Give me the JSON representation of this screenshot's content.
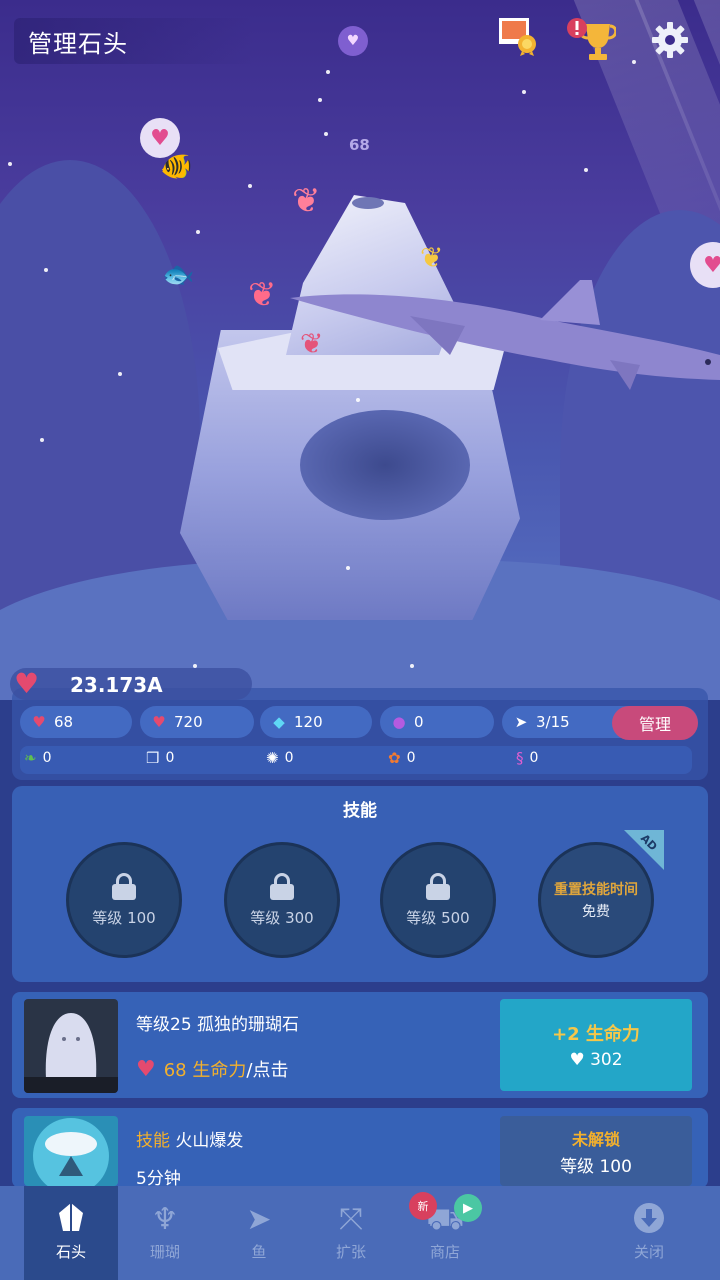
{
  "header": {
    "title": "管理石头",
    "floating_number": "68"
  },
  "stats": {
    "life_total": "23.173A",
    "chips": [
      {
        "icon": "heart-tap-icon",
        "value": "68"
      },
      {
        "icon": "heart-auto-icon",
        "value": "720"
      },
      {
        "icon": "diamond-icon",
        "value": "120"
      },
      {
        "icon": "pearl-icon",
        "value": "0"
      },
      {
        "icon": "fish-count-icon",
        "value": "3/15"
      }
    ],
    "manage_label": "管理",
    "resources": [
      {
        "icon": "seaweed-icon",
        "value": "0"
      },
      {
        "icon": "coral-piece-icon",
        "value": "0"
      },
      {
        "icon": "urchin-icon",
        "value": "0"
      },
      {
        "icon": "shell-icon",
        "value": "0"
      },
      {
        "icon": "seahorse-icon",
        "value": "0"
      }
    ]
  },
  "skills": {
    "title": "技能",
    "slots": [
      {
        "level_label": "等级 100"
      },
      {
        "level_label": "等级 300"
      },
      {
        "level_label": "等级 500"
      }
    ],
    "reset": {
      "label": "重置技能时间",
      "price": "免费",
      "ad_tag": "AD"
    }
  },
  "upgrades": [
    {
      "title": "等级25 孤独的珊瑚石",
      "value": "68 生命力",
      "suffix": "/点击",
      "button_main": "+2 生命力",
      "button_cost": "302"
    },
    {
      "title_prefix": "技能",
      "title": "火山爆发",
      "subtitle": "5分钟",
      "button_main": "未解锁",
      "button_level": "等级 100"
    }
  ],
  "nav": {
    "items": [
      {
        "label": "石头",
        "icon": "rock-icon",
        "active": true
      },
      {
        "label": "珊瑚",
        "icon": "coral-icon",
        "active": false
      },
      {
        "label": "鱼",
        "icon": "fish-icon",
        "active": false
      },
      {
        "label": "扩张",
        "icon": "expand-icon",
        "active": false
      },
      {
        "label": "商店",
        "icon": "shop-cart-icon",
        "active": false
      },
      {
        "label": "关闭",
        "icon": "close-download-icon",
        "active": false
      }
    ],
    "new_badge": "新"
  },
  "colors": {
    "accent_orange": "#f2b02d",
    "upgrade_button": "#23a6c8",
    "manage_button": "#c84a7b",
    "heart": "#e44a6f"
  }
}
